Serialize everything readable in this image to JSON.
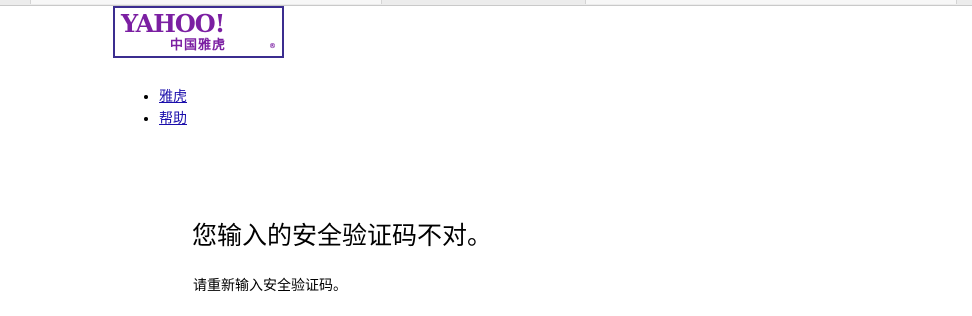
{
  "logo": {
    "wordmark": "YAHOO!",
    "subtitle": "中国雅虎",
    "registered": "®",
    "brand_color": "#7b1fa2",
    "border_color": "#3b2d8f"
  },
  "nav": {
    "items": [
      {
        "label": "雅虎"
      },
      {
        "label": "帮助"
      }
    ],
    "link_color": "#1a0dab"
  },
  "error": {
    "title": "您输入的安全验证码不对。",
    "message": "请重新输入安全验证码。"
  }
}
